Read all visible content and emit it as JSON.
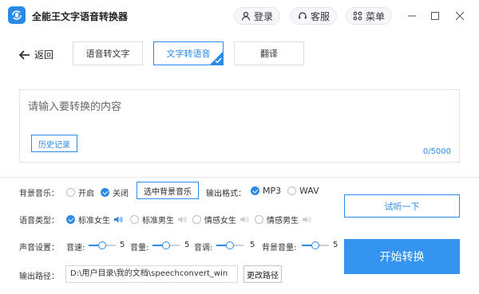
{
  "app": {
    "title": "全能王文字语音转换器",
    "accent": "#2a8ae6",
    "buttons": {
      "login": "登录",
      "service": "客服",
      "menu": "菜单"
    }
  },
  "nav": {
    "back": "返回",
    "tabs": [
      {
        "label": "语音转文字",
        "active": false
      },
      {
        "label": "文字转语音",
        "active": true
      },
      {
        "label": "翻译",
        "active": false
      }
    ]
  },
  "editor": {
    "placeholder": "请输入要转换的内容",
    "history_label": "历史记录",
    "counter": "0/5000"
  },
  "settings": {
    "bg_music": {
      "label": "背景音乐：",
      "options": [
        "开启",
        "关闭"
      ],
      "selected": "关闭",
      "select_button": "选中背景音乐"
    },
    "output_format": {
      "label": "输出格式：",
      "options": [
        "MP3",
        "WAV"
      ],
      "selected": "MP3"
    },
    "voice_type": {
      "label": "语音类型：",
      "options": [
        "标准女生",
        "标准男生",
        "情感女生",
        "情感男生"
      ],
      "selected": "标准女生"
    },
    "sound": {
      "label": "声音设置：",
      "sliders": [
        {
          "label": "音速:",
          "value": "5",
          "level": 0.5
        },
        {
          "label": "音量:",
          "value": "5",
          "level": 0.5
        },
        {
          "label": "音调:",
          "value": "5",
          "level": 0.5
        },
        {
          "label": "背景音量:",
          "value": "5",
          "level": 0.5
        }
      ]
    },
    "output_path": {
      "label": "输出路径：",
      "value": "D:\\用户目录\\我的文档\\speechconvert_win",
      "change_button": "更改路径"
    }
  },
  "actions": {
    "preview": "试听一下",
    "start": "开始转换"
  }
}
